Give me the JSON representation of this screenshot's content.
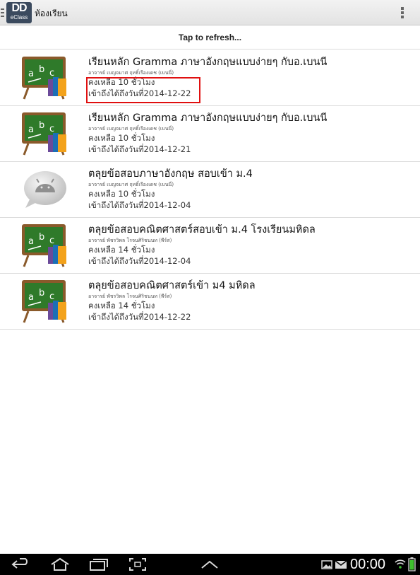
{
  "app": {
    "logo_main": "DD",
    "logo_sub": "eClass",
    "title": "ห้องเรียน"
  },
  "refresh_label": "Tap to refresh...",
  "courses": [
    {
      "title": "เรียนหลัก Gramma ภาษาอังกฤษแบบง่ายๆ กับอ.เบนนี่",
      "teacher": "อาจารย์ เบญจมาศ ฤทธิ์เรืองเดช  (เบนนี่)",
      "remaining": "คงเหลือ 10 ชั่วโมง",
      "access": "เข้าถึงได้ถึงวันที่2014-12-22",
      "icon": "chalkboard-abc-icon"
    },
    {
      "title": "เรียนหลัก Gramma ภาษาอังกฤษแบบง่ายๆ กับอ.เบนนี่",
      "teacher": "อาจารย์ เบญจมาศ ฤทธิ์เรืองเดช  (เบนนี่)",
      "remaining": "คงเหลือ 10 ชั่วโมง",
      "access": "เข้าถึงได้ถึงวันที่2014-12-21",
      "icon": "chalkboard-abc-icon"
    },
    {
      "title": "ตลุยข้อสอบภาษาอังกฤษ สอบเข้า ม.4",
      "teacher": "อาจารย์ เบญจมาศ ฤทธิ์เรืองเดช  (เบนนี่)",
      "remaining": "คงเหลือ 10 ชั่วโมง",
      "access": "เข้าถึงได้ถึงวันที่2014-12-04",
      "icon": "android-placeholder-icon"
    },
    {
      "title": "ตลุยข้อสอบคณิตศาสตร์สอบเข้า ม.4 โรงเรียนมหิดล",
      "teacher": "อาจารย์ พัชรวิพล โรจนศิริชนนท (พีร์ส)",
      "remaining": "คงเหลือ 14 ชั่วโมง",
      "access": "เข้าถึงได้ถึงวันที่2014-12-04",
      "icon": "chalkboard-abc-icon"
    },
    {
      "title": "ตลุยข้อสอบคณิตศาสตร์เข้า ม4 มหิดล",
      "teacher": "อาจารย์ พัชรวิพล โรจนศิริชนนท (พีร์ส)",
      "remaining": "คงเหลือ 14 ชั่วโมง",
      "access": "เข้าถึงได้ถึงวันที่2014-12-22",
      "icon": "chalkboard-abc-icon"
    }
  ],
  "status": {
    "time": "00:00"
  },
  "colors": {
    "chalkboard": "#2f7a2a",
    "frame": "#8a5a2b",
    "highlight": "#e01010",
    "navbar": "#000000"
  }
}
